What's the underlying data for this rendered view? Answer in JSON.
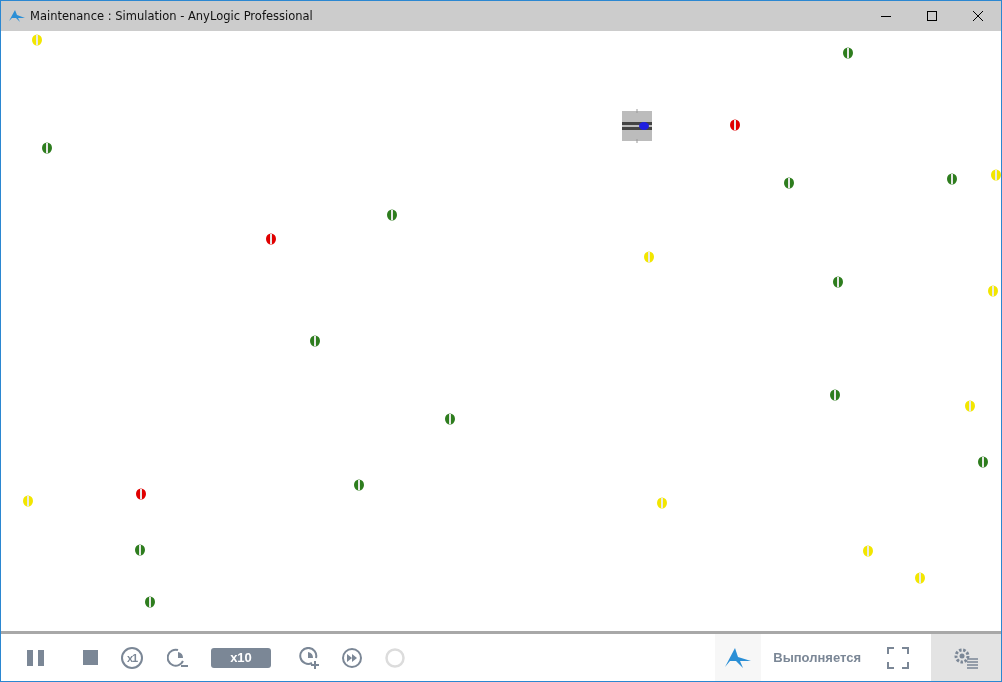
{
  "window": {
    "title": "Maintenance : Simulation - AnyLogic Professional"
  },
  "canvas": {
    "markers": [
      {
        "color": "#f2e600"
      },
      {
        "color": "#2e7d1e"
      },
      {
        "color": "#e00000"
      },
      {
        "color": "#2e7d1e"
      },
      {
        "color": "#f2e600"
      },
      {
        "color": "#2e7d1e"
      },
      {
        "color": "#2e7d1e"
      },
      {
        "color": "#2e7d1e"
      },
      {
        "color": "#e00000"
      },
      {
        "color": "#f2e600"
      },
      {
        "color": "#2e7d1e"
      },
      {
        "color": "#f2e600"
      },
      {
        "color": "#2e7d1e"
      },
      {
        "color": "#2e7d1e"
      },
      {
        "color": "#f2e600"
      },
      {
        "color": "#2e7d1e"
      },
      {
        "color": "#2e7d1e"
      },
      {
        "color": "#2e7d1e"
      },
      {
        "color": "#e00000"
      },
      {
        "color": "#f2e600"
      },
      {
        "color": "#f2e600"
      },
      {
        "color": "#2e7d1e"
      },
      {
        "color": "#f2e600"
      },
      {
        "color": "#f2e600"
      },
      {
        "color": "#2e7d1e"
      }
    ]
  },
  "toolbar": {
    "realtime_label": "x1",
    "speed": "x10",
    "status": "Выполняется"
  }
}
